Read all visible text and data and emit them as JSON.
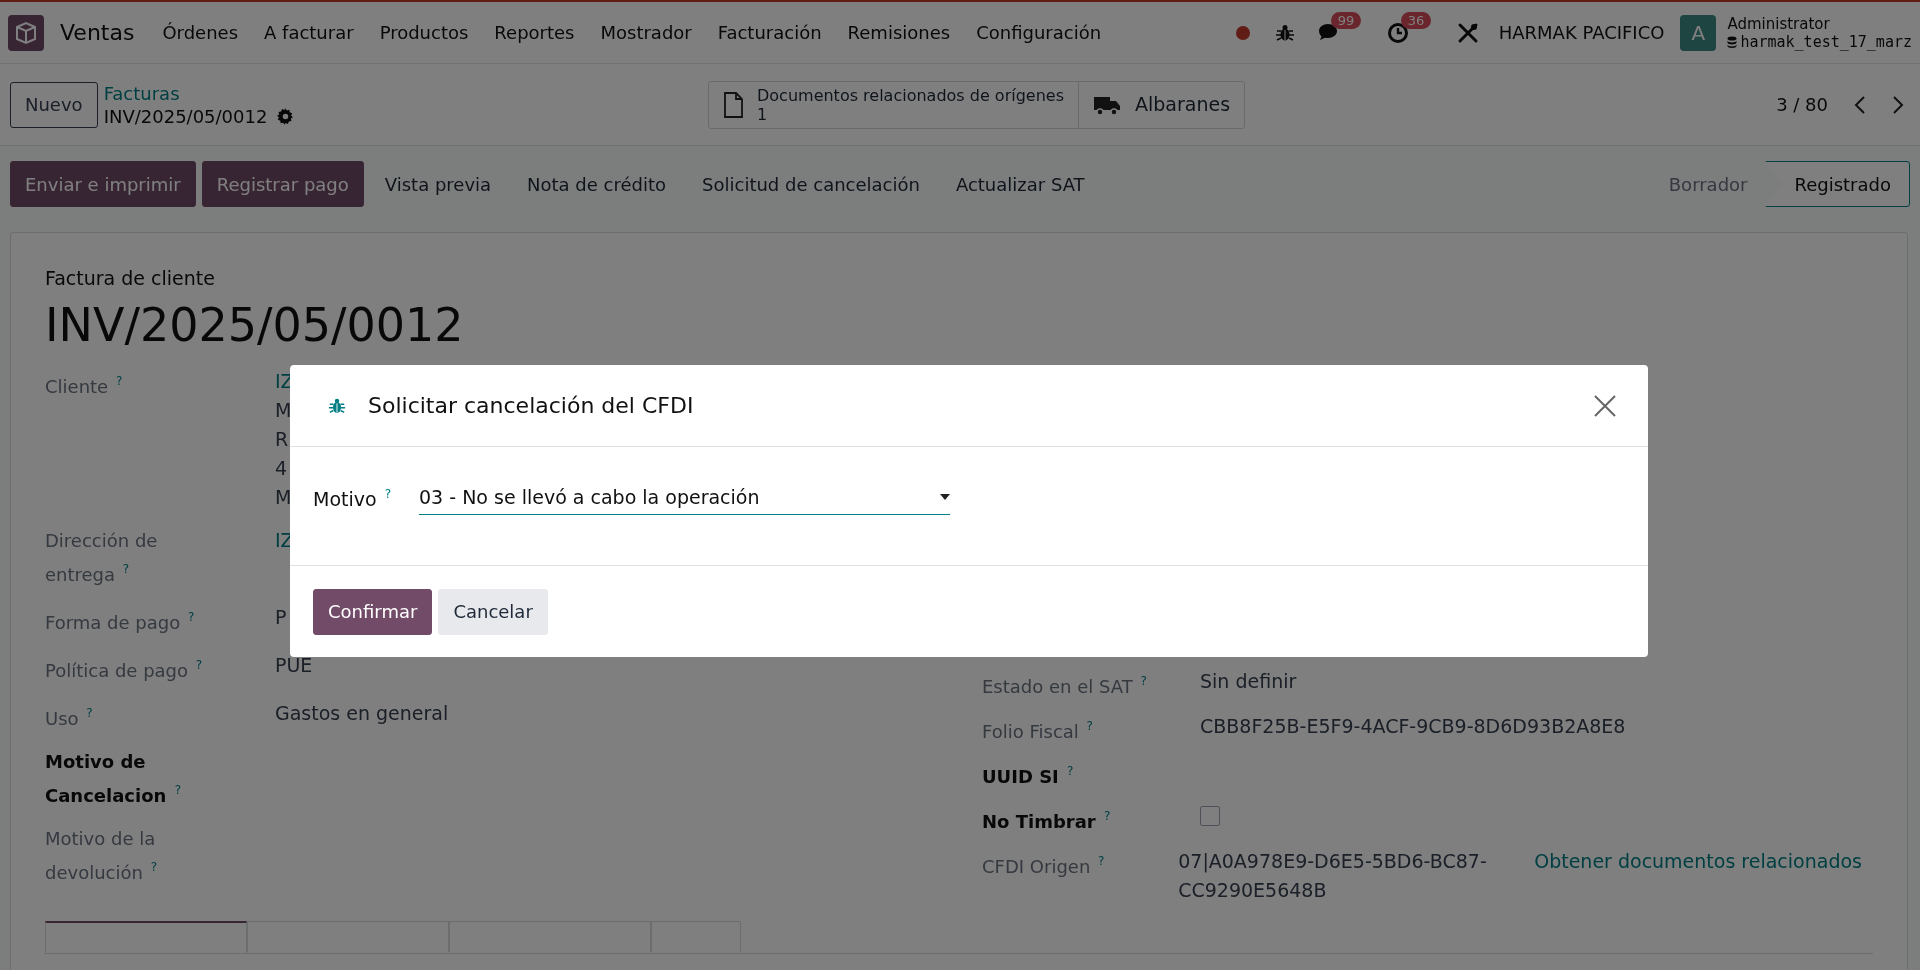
{
  "navbar": {
    "app_name": "Ventas",
    "menu": [
      "Órdenes",
      "A facturar",
      "Productos",
      "Reportes",
      "Mostrador",
      "Facturación",
      "Remisiones",
      "Configuración"
    ],
    "messages_count": "99",
    "activities_count": "36",
    "company": "HARMAK PACIFICO",
    "user": {
      "avatar_letter": "A",
      "name": "Administrator",
      "database": "harmak_test_17_marz"
    }
  },
  "control_panel": {
    "new_button": "Nuevo",
    "breadcrumb": {
      "parent": "Facturas",
      "current": "INV/2025/05/0012"
    },
    "smart_buttons": [
      {
        "kind": "document",
        "label": "Documentos relacionados de orígenes",
        "value": "1"
      },
      {
        "kind": "truck",
        "label": "Albaranes"
      }
    ],
    "pager": "3 / 80"
  },
  "action_buttons": [
    {
      "label": "Enviar e imprimir",
      "kind": "primary"
    },
    {
      "label": "Registrar pago",
      "kind": "primary"
    },
    {
      "label": "Vista previa",
      "kind": "link"
    },
    {
      "label": "Nota de crédito",
      "kind": "link"
    },
    {
      "label": "Solicitud de cancelación",
      "kind": "link"
    },
    {
      "label": "Actualizar SAT",
      "kind": "link"
    }
  ],
  "status_bar": [
    {
      "label": "Borrador",
      "selected": false
    },
    {
      "label": "Registrado",
      "selected": true
    }
  ],
  "form": {
    "subtitle": "Factura de cliente",
    "title": "INV/2025/05/0012",
    "left_fields": [
      {
        "label": "Cliente $^{?}$",
        "required": false,
        "kind": "text",
        "values": [
          {
            "text": "IZ",
            "link": true
          },
          {
            "text": "M",
            "link": false
          },
          {
            "text": "R",
            "link": false
          },
          {
            "text": "4",
            "link": false
          },
          {
            "text": "M",
            "link": false
          }
        ]
      },
      {
        "label": "Dirección de entrega $^{?}$",
        "required": false,
        "kind": "text",
        "values": [
          {
            "text": "IZ",
            "link": true
          }
        ]
      },
      {
        "label": "Forma de pago $^{?}$",
        "required": false,
        "kind": "text",
        "values": [
          {
            "text": "P",
            "link": false
          }
        ]
      },
      {
        "label": "Política de pago $^{?}$",
        "required": false,
        "kind": "text",
        "values": [
          {
            "text": "PUE",
            "link": false
          }
        ]
      },
      {
        "label": "Uso $^{?}$",
        "required": false,
        "kind": "text",
        "values": [
          {
            "text": "Gastos en general",
            "link": false
          }
        ]
      },
      {
        "label": "Motivo de Cancelacion $^{?}$",
        "required": true,
        "kind": "text"
      },
      {
        "label": "Motivo de la devolución $^{?}$",
        "required": false,
        "kind": "text"
      }
    ],
    "right_fields": [
      {
        "label": "Estado en el SAT $^{?}$",
        "required": false,
        "kind": "text",
        "values": [
          {
            "text": "Sin definir",
            "link": false
          }
        ]
      },
      {
        "label": "Folio Fiscal $^{?}$",
        "required": false,
        "kind": "text",
        "values": [
          {
            "text": "CBB8F25B-E5F9-4ACF-9CB9-8D6D93B2A8E8",
            "link": false
          }
        ]
      },
      {
        "label": "UUID SI $^{?}$",
        "required": true,
        "kind": "text"
      },
      {
        "label": "No Timbrar $^{?}$",
        "required": true,
        "kind": "checkbox",
        "checked": false
      },
      {
        "label": "CFDI Origen $^{?}$",
        "required": false,
        "kind": "text",
        "values": [
          {
            "text": "07|A0A978E9-D6E5-5BD6-BC87-CC9290E5648B",
            "link": false
          }
        ],
        "action": "Obtener documentos relacionados"
      }
    ],
    "tabs": [
      {
        "selected": true
      },
      {
        "selected": false
      },
      {
        "selected": false
      },
      {
        "selected": false
      }
    ]
  },
  "dialog": {
    "title": "Solicitar cancelación del CFDI",
    "field": {
      "label": "Motivo $^{?}$",
      "value": "03 - No se llevó a cabo la operación"
    },
    "buttons": [
      {
        "label": "Confirmar",
        "kind": "primary"
      },
      {
        "label": "Cancelar",
        "kind": "secondary"
      }
    ]
  }
}
